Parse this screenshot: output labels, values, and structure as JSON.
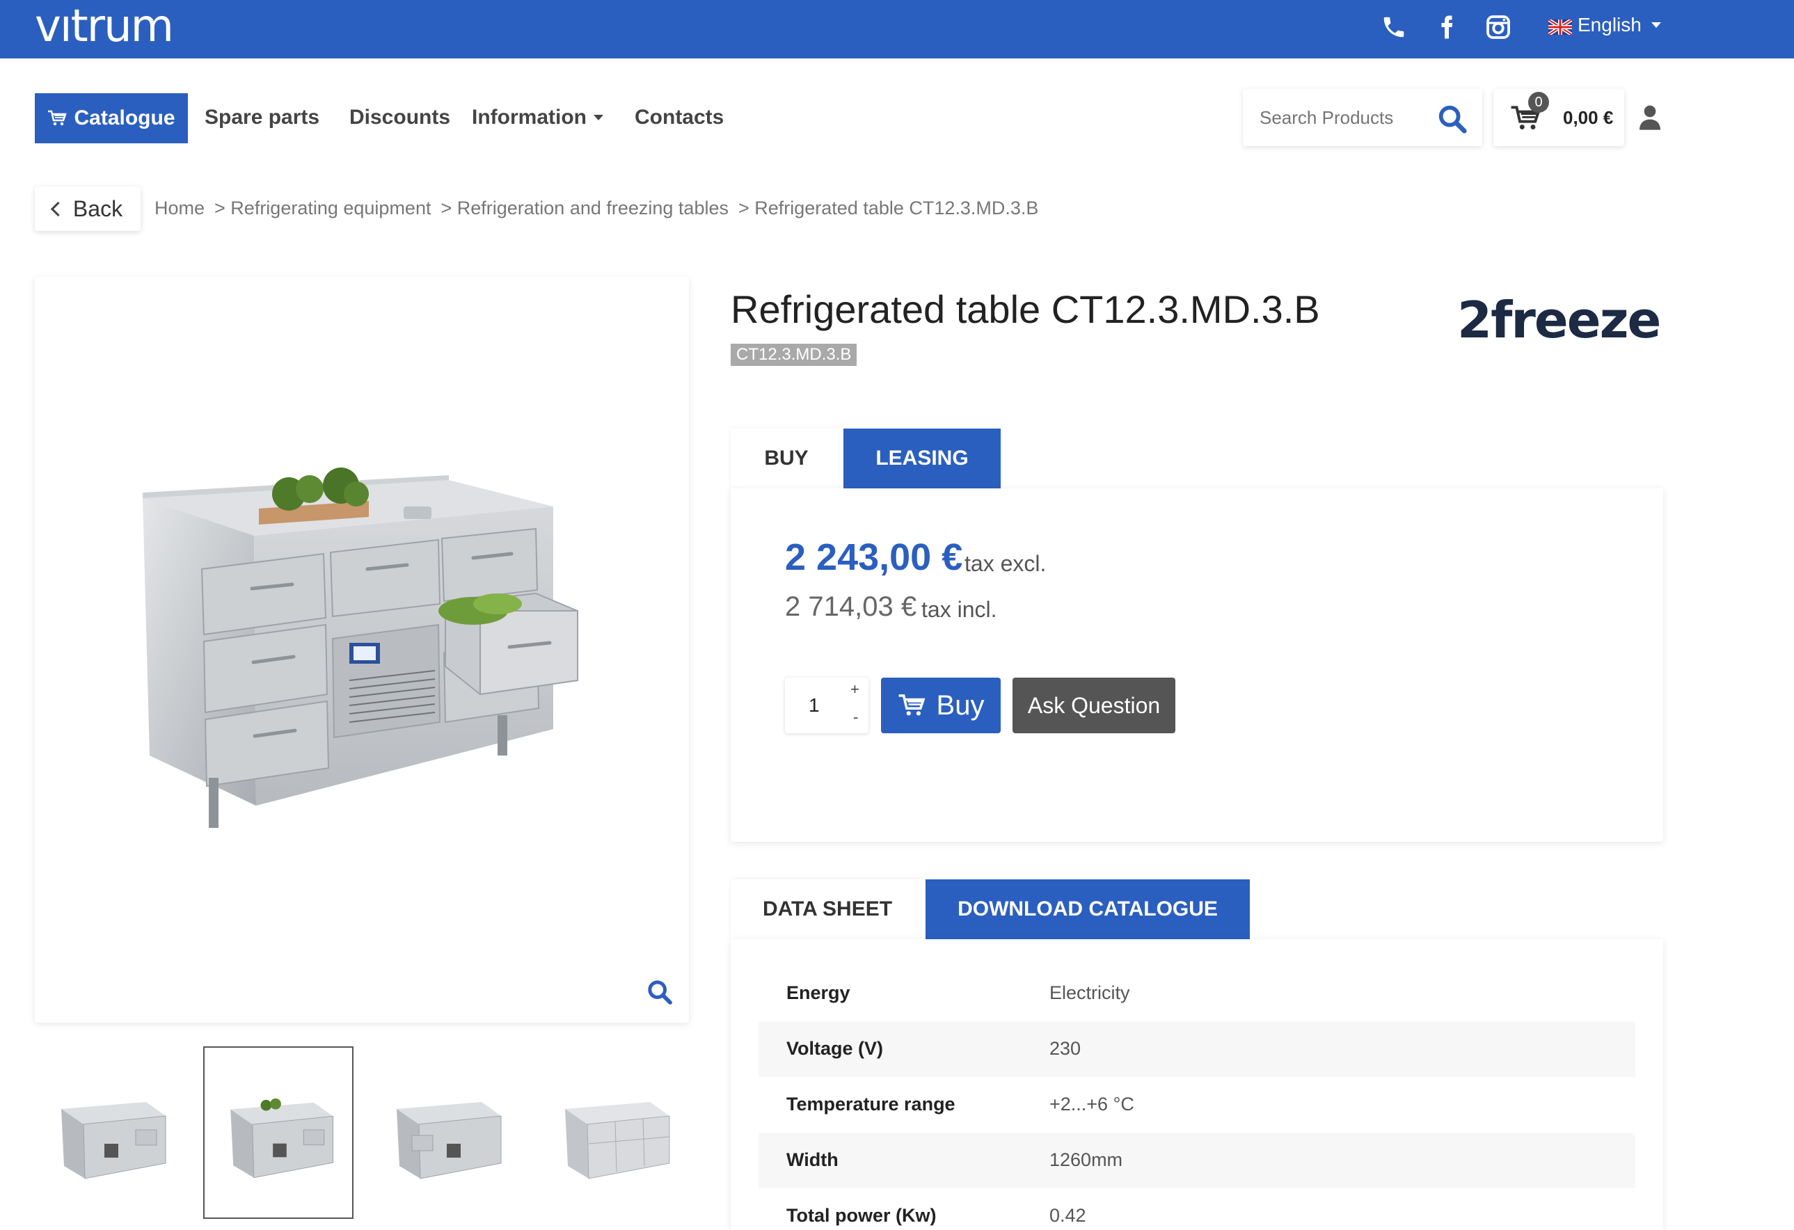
{
  "header": {
    "logo_text": "vıtrum",
    "language": "English"
  },
  "icons": {
    "phone": "phone-icon",
    "facebook": "facebook-icon",
    "instagram": "instagram-icon",
    "flag": "uk-flag-icon",
    "cart": "cart-icon",
    "search": "search-icon",
    "user": "user-icon",
    "zoom": "zoom-icon"
  },
  "nav": {
    "catalogue": "Catalogue",
    "spare_parts": "Spare parts",
    "discounts": "Discounts",
    "information": "Information",
    "contacts": "Contacts"
  },
  "search": {
    "placeholder": "Search Products"
  },
  "cart": {
    "count": "0",
    "total": "0,00 €"
  },
  "breadcrumb": {
    "back": "Back",
    "items": [
      "Home",
      "> Refrigerating equipment",
      "> Refrigeration and freezing tables",
      "> Refrigerated table CT12.3.MD.3.B"
    ]
  },
  "product": {
    "title": "Refrigerated table CT12.3.MD.3.B",
    "sku": "CT12.3.MD.3.B",
    "brand": "2freeze"
  },
  "purchase_tabs": [
    "BUY",
    "LEASING"
  ],
  "price": {
    "excl": "2 243,00 €",
    "excl_label": "tax excl.",
    "incl": "2 714,03 €",
    "incl_label": "tax incl."
  },
  "quantity": {
    "value": "1",
    "plus": "+",
    "minus": "-"
  },
  "actions": {
    "buy": "Buy",
    "ask": "Ask Question"
  },
  "info_tabs": [
    "DATA SHEET",
    "DOWNLOAD CATALOGUE"
  ],
  "specs": [
    {
      "label": "Energy",
      "value": "Electricity"
    },
    {
      "label": "Voltage (V)",
      "value": "230"
    },
    {
      "label": "Temperature range",
      "value": "+2...+6 °C"
    },
    {
      "label": "Width",
      "value": "1260mm"
    },
    {
      "label": "Total power (Kw)",
      "value": "0.42"
    }
  ],
  "colors": {
    "brand_blue": "#2b5fbf",
    "dark_button": "#555555"
  }
}
